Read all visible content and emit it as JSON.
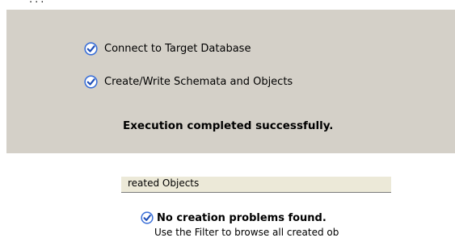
{
  "header_fragment": "...",
  "tasks": [
    {
      "label": "Connect to Target Database",
      "icon": "check-circle-icon"
    },
    {
      "label": "Create/Write Schemata and Objects",
      "icon": "check-circle-icon"
    }
  ],
  "execution_message": "Execution completed successfully.",
  "objects_panel": {
    "tab_label": "reated Objects",
    "result_title": "No creation problems found.",
    "result_hint": "Use the Filter to browse all created ob",
    "icon": "check-circle-icon"
  },
  "colors": {
    "panel_bg": "#d4d0c8",
    "tab_bg": "#ece9d8",
    "check_blue": "#3a6fd8"
  }
}
